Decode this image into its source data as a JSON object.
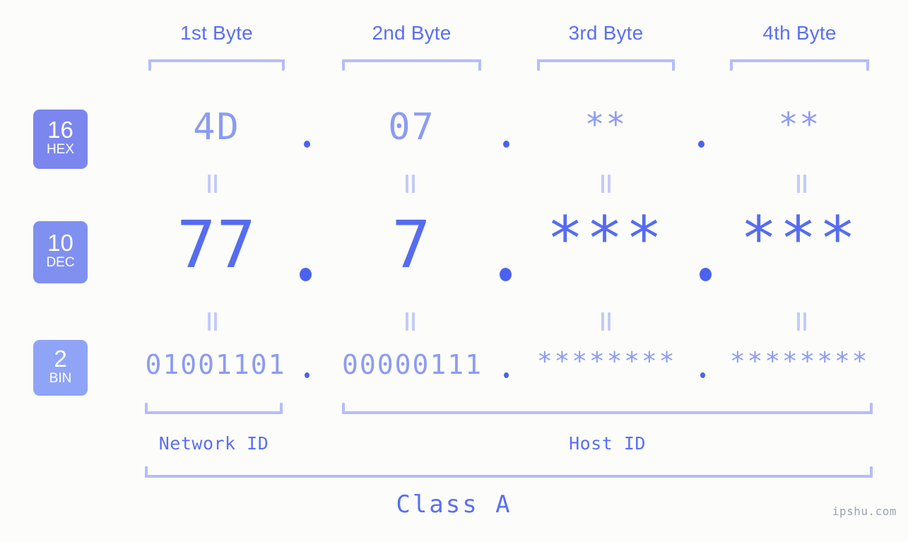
{
  "background_color": "#fcfdfa",
  "accent_colors": {
    "primary_text": "#5b6ef5",
    "strong_value": "#566cf0",
    "muted_value": "#8c9bf3",
    "bracket": "#b4bdfb",
    "connector": "#c3caf9",
    "dot": "#4a63ee",
    "badge_hex": "#7b86ef",
    "badge_dec": "#8090f0",
    "badge_bin": "#8fa4f6",
    "watermark": "#9aa3b2"
  },
  "byte_headers": [
    {
      "label": "1st Byte"
    },
    {
      "label": "2nd Byte"
    },
    {
      "label": "3rd Byte"
    },
    {
      "label": "4th Byte"
    }
  ],
  "rows": {
    "hex": {
      "badge_number": "16",
      "badge_abbr": "HEX",
      "values": [
        "4D",
        "07",
        "**",
        "**"
      ],
      "separator": "."
    },
    "dec": {
      "badge_number": "10",
      "badge_abbr": "DEC",
      "values": [
        "77",
        "7",
        "***",
        "***"
      ],
      "separator": "."
    },
    "bin": {
      "badge_number": "2",
      "badge_abbr": "BIN",
      "values": [
        "01001101",
        "00000111",
        "********",
        "********"
      ],
      "separator": "."
    }
  },
  "connectors": {
    "symbol": "equals-rotated",
    "hex_to_dec_count": 4,
    "dec_to_bin_count": 4
  },
  "sections": [
    {
      "label": "Network ID"
    },
    {
      "label": "Host ID"
    }
  ],
  "class": {
    "label": "Class A"
  },
  "watermark": {
    "text": "ipshu.com"
  }
}
